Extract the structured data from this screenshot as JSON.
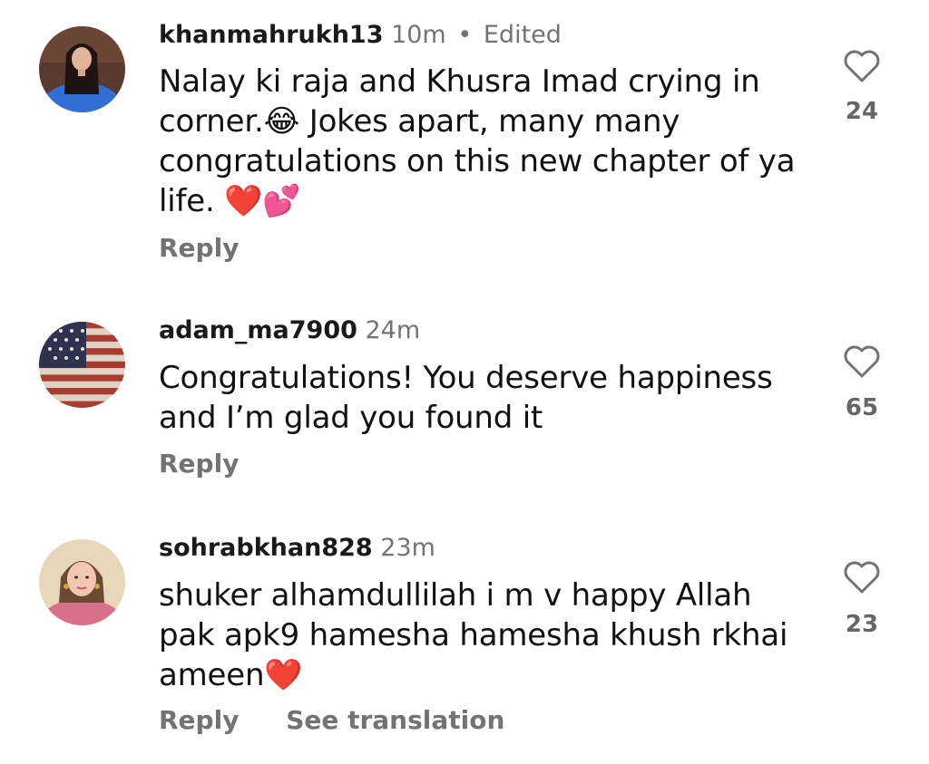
{
  "comments": [
    {
      "username": "khanmahrukh13",
      "time": "10m",
      "separator": "•",
      "edited": "Edited",
      "text": "Nalay ki raja and Khusra Imad crying in corner.😂 Jokes apart, many many congratulations on this new chapter of ya life. ❤️💕",
      "reply_label": "Reply",
      "like_icon": "heart-outline-icon",
      "likes": "24"
    },
    {
      "username": "adam_ma7900",
      "time": "24m",
      "text": "Congratulations! You deserve happiness and I’m glad you found it",
      "reply_label": "Reply",
      "like_icon": "heart-outline-icon",
      "likes": "65"
    },
    {
      "username": "sohrabkhan828",
      "time": "23m",
      "text": "shuker alhamdullilah i m v happy Allah pak apk9 hamesha hamesha khush rkhai ameen❤️",
      "reply_label": "Reply",
      "translate_label": "See translation",
      "like_icon": "heart-outline-icon",
      "likes": "23"
    }
  ],
  "colors": {
    "text": "#111111",
    "secondary": "#737373",
    "background": "#ffffff"
  }
}
